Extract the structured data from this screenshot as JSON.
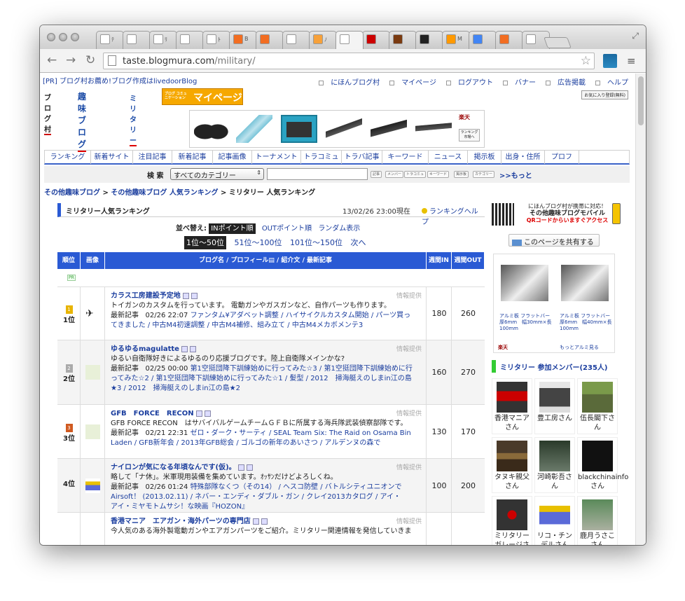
{
  "browser": {
    "url_host": "taste.blogmura.com",
    "url_path": "/military/",
    "tabs": [
      "ﾃ",
      "",
      "ﾘ",
      "",
      "ﾄ",
      "B",
      "",
      "",
      "ﾉ",
      "",
      "",
      "",
      "",
      "M",
      "",
      "",
      "",
      "",
      "",
      "",
      "",
      "",
      ""
    ]
  },
  "topbar": {
    "pr_text": "[PR] ブログ村お薦め!ブログ作成はlivedoorBlog",
    "links": [
      "にほんブログ村",
      "マイページ",
      "ログアウト",
      "バナー",
      "広告掲載",
      "ヘルプ"
    ],
    "register_badge": "お気に入り登録(無料)"
  },
  "logos": {
    "blogmura": "ブログ村",
    "hobby": "趣味ブログ",
    "military": "ミリタリー",
    "mypage_small": "ブログ コミュニケーション",
    "mypage": "マイページ"
  },
  "banner": {
    "shop": "楽天",
    "btn": "ランキング 市場へ"
  },
  "menu": [
    "ランキング",
    "新着サイト",
    "注目記事",
    "新着記事",
    "記事画像",
    "トーナメント",
    "トラコミュ",
    "トラバ記事",
    "キーワード",
    "ニュース",
    "掲示板",
    "出身・住所",
    "プロフ"
  ],
  "search": {
    "label": "検 索",
    "category": "すべてのカテゴリー",
    "buttons": [
      "記事",
      "メンバー",
      "トラコミュ",
      "キーワード",
      "掲示板",
      "カテゴリー"
    ],
    "more": ">>もっと"
  },
  "breadcrumb": {
    "a": "その他趣味ブログ",
    "b": "その他趣味ブログ 人気ランキング",
    "c": "ミリタリー 人気ランキング",
    "sep": ">"
  },
  "ranking": {
    "title": "ミリタリー人気ランキング",
    "date": "13/02/26 23:00現在",
    "help": "ランキングヘルプ",
    "sort_label": "並べ替え:",
    "sort_in": "INポイント順",
    "sort_out": "OUTポイント順",
    "sort_random": "ランダム表示",
    "page_current": "1位〜50位",
    "page_2": "51位〜100位",
    "page_3": "101位〜150位",
    "page_next": "次へ",
    "cols": [
      "順位",
      "画像",
      "ブログ名 / プロフィール▤ / 紹介文 / 最新記事",
      "週間IN",
      "週間OUT"
    ],
    "pr_badge": "PR",
    "info_label": "情報提供",
    "latest_label": "最新記事",
    "rows": [
      {
        "rank": "1位",
        "name": "カラス工房建設予定地",
        "desc": "トイガンのカスタムを行っています。 電動ガンやガスガンなど、自作パーツも作ります。",
        "date": "02/26 22:07",
        "latest_line1": "ファンタム¥アダベット調整 / ハイサイクルカスタム開始 / パーツ買っ",
        "latest_line2": "てきました / 中古M4初速調整 / 中古M4補修、組み立て / 中古M4メカボメンテ3",
        "in": "180",
        "out": "260"
      },
      {
        "rank": "2位",
        "name": "ゆるゆるmagulatte",
        "desc": "ゆるい自衛隊好きによるゆるのり応援ブログです。陸上自衛隊メインかな?",
        "date": "02/25 00:00",
        "latest_line1": "第1空挺団降下訓練始めに行ってみた☆3 / 第1空挺団降下訓練始めに行",
        "latest_line2": "ってみた☆2 / 第1空挺団降下訓練始めに行ってみた☆1 / 髪型 / 2012　掃海艇えのしまin江の島",
        "latest_line3": "★3 / 2012　掃海艇えのしまin江の島★2",
        "in": "160",
        "out": "270"
      },
      {
        "rank": "3位",
        "name": "GFB　FORCE　RECON",
        "desc": "GFB FORCE RECON　はサバイバルゲームチームＧＦＢに所属する海兵隊武装偵察部隊です。",
        "date": "02/21 22:31",
        "latest_line1": "ゼロ・ダーク・サーティ / SEAL Team Six: The Raid on Osama Bin",
        "latest_line2": "Laden / GFB新年会 / 2013年GFB総会 / ゴルゴの新年のあいさつ / アルデンヌの森で",
        "in": "130",
        "out": "170"
      },
      {
        "rank": "4位",
        "name": "ナイロンが気になる年頃なんです(仮)。",
        "desc": "略して「ナ休」。米軍現用装備を集めています。ｵｯｻﾝだけどよろしくね。",
        "date": "02/26 01:24",
        "latest_line1": "特殊部隊なくつ（その14） / ヘスコ防壁 / バトルシティユニオンで",
        "latest_line2": "Airsoft！ (2013.02.11) / ネバー・エンディ・ダブル・ガン / クレイ2013カタログ / アイ・",
        "latest_line3": "アイ・ミヤモトムサシ！な映画『HOZON』",
        "in": "100",
        "out": "200"
      },
      {
        "rank": "",
        "name": "香港マニア　エアガン・海外パーツの専門店",
        "desc": "今人気のある海外製電動ガンやエアガンパーツをご紹介。ミリタリー関連情報を発信していきま"
      }
    ]
  },
  "sidebar": {
    "mobile_line1": "にほんブログ村が携帯に対応！",
    "mobile_line2": "その他趣味ブログモバイル",
    "mobile_line3": "QRコードからいますぐアクセス",
    "share": "このページを共有する",
    "ad1": "アルミ板 フラットバー　厚6mm　幅30mm×長100mm",
    "ad2": "アルミ板 フラットバー　厚6mm　幅40mm×長100mm",
    "ad_shop": "楽天",
    "ad_more": "もっとアルミ見る",
    "members_title": "ミリタリー 参加メンバー(235人)",
    "members": [
      "香港マニアさん",
      "豊工房さん",
      "伍長閣下さん",
      "タヌキ親父さん",
      "河崎彰吾さん",
      "blackchinainfoさん",
      "ミリタリーガレージさん",
      "リコ・チンデルさん",
      "鹿月うさこさん"
    ]
  }
}
